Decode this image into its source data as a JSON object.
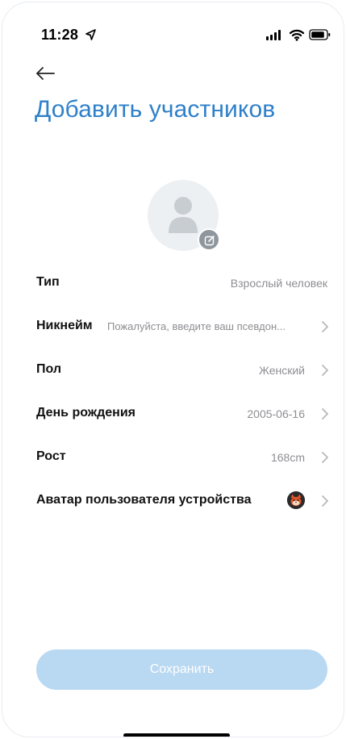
{
  "status_bar": {
    "time": "11:28"
  },
  "header": {
    "title": "Добавить участников"
  },
  "form": {
    "type_label": "Тип",
    "type_value": "Взрослый человек",
    "nickname_label": "Никнейм",
    "nickname_placeholder": "Пожалуйста, введите ваш псевдон...",
    "gender_label": "Пол",
    "gender_value": "Женский",
    "birthday_label": "День рождения",
    "birthday_value": "2005-06-16",
    "height_label": "Рост",
    "height_value": "168cm",
    "device_avatar_label": "Аватар пользователя устройства"
  },
  "actions": {
    "save_label": "Сохранить"
  },
  "colors": {
    "title": "#2f80c9",
    "save_button_bg": "#b9d8f2",
    "secondary_text": "#8e8e93"
  }
}
